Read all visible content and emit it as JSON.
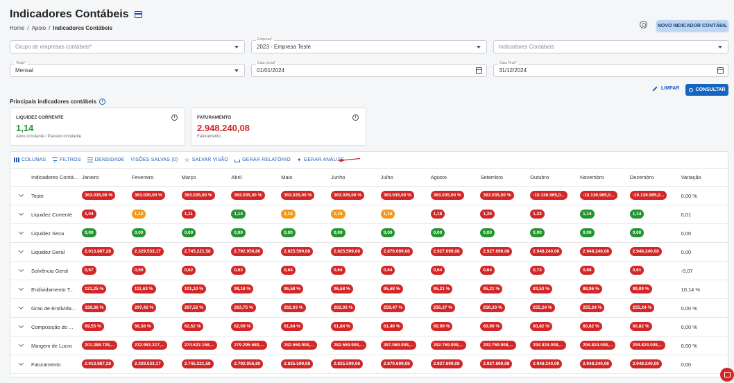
{
  "page": {
    "title": "Indicadores Contábeis",
    "breadcrumb": [
      "Home",
      "/",
      "Apoio",
      "/",
      "Indicadores Contábeis"
    ],
    "new_button": "NOVO INDICADOR CONTÁBIL"
  },
  "filters": {
    "grupo": {
      "placeholder": "Grupo de empresas contábeis*"
    },
    "empresa": {
      "label": "Empresa*",
      "value": "2023 - Empresa Teste"
    },
    "indicadores": {
      "placeholder": "Indicadores Contabeis"
    },
    "visao": {
      "label": "Visão*",
      "value": "Mensal"
    },
    "data_inicial": {
      "label": "Data Inicial*",
      "value": "01/01/2024"
    },
    "data_final": {
      "label": "Data Final*",
      "value": "31/12/2024"
    },
    "clear_button": "LIMPAR",
    "search_button": "CONSULTAR"
  },
  "summary": {
    "title": "Principais indicadores contábeis",
    "cards": [
      {
        "title": "LIQUIDEZ CORRENTE",
        "value": "1,14",
        "subtitle": "Ativo circulante / Passivo circulante",
        "color": "#23952f"
      },
      {
        "title": "FATURAMENTO",
        "value": "2.948.240,08",
        "subtitle": "Faturamento",
        "color": "#d32626"
      }
    ]
  },
  "toolbar": {
    "columns": "COLUNAS",
    "filters": "FILTROS",
    "density": "DENSIDADE",
    "saved_views": "VISÕES SALVAS (0)",
    "save_view": "SALVAR VISÃO",
    "report": "GERAR RELATÓRIO",
    "analysis": "GERAR ANÁLISE"
  },
  "table": {
    "headers": [
      "Indicadores Contá...",
      "Janeiro",
      "Fevereiro",
      "Março",
      "Abril",
      "Maio",
      "Junho",
      "Julho",
      "Agosto",
      "Setembro",
      "Outubro",
      "Novembro",
      "Dezembro",
      "Variação"
    ],
    "rows": [
      {
        "name": "Teste",
        "values": [
          "363.035,00 %",
          "363.035,00 %",
          "363.035,00 %",
          "363.035,00 %",
          "363.035,00 %",
          "363.035,00 %",
          "363.035,00 %",
          "363.035,00 %",
          "363.035,00 %",
          "-10.136.965,0...",
          "-10.136.965,0...",
          "-10.136.965,0..."
        ],
        "colors": [
          "r",
          "r",
          "r",
          "r",
          "r",
          "r",
          "r",
          "r",
          "r",
          "r",
          "r",
          "r"
        ],
        "variation": "0,00 %"
      },
      {
        "name": "Liquidez Corrente",
        "values": [
          "1,04",
          "1,12",
          "1,11",
          "1,14",
          "1,15",
          "1,15",
          "1,16",
          "1,18",
          "1,20",
          "1,22",
          "1,14",
          "1,14"
        ],
        "colors": [
          "r",
          "o",
          "r",
          "g",
          "o",
          "o",
          "o",
          "r",
          "r",
          "r",
          "g",
          "g"
        ],
        "variation": "0,01"
      },
      {
        "name": "Liquidez Seca",
        "values": [
          "0,00",
          "0,00",
          "0,00",
          "0,00",
          "0,00",
          "0,00",
          "0,00",
          "0,00",
          "0,00",
          "0,00",
          "0,00",
          "0,00"
        ],
        "colors": [
          "g",
          "g",
          "g",
          "g",
          "g",
          "g",
          "g",
          "g",
          "g",
          "g",
          "g",
          "g"
        ],
        "variation": "0,00"
      },
      {
        "name": "Liquidez Geral",
        "values": [
          "2.013.887,28",
          "2.329.533,17",
          "2.745.221,58",
          "2.792.956,80",
          "2.825.599,08",
          "2.825.599,08",
          "2.870.699,08",
          "2.927.699,08",
          "2.927.699,08",
          "2.948.240,08",
          "2.948.240,08",
          "2.948.240,08"
        ],
        "colors": [
          "r",
          "r",
          "r",
          "r",
          "r",
          "r",
          "r",
          "r",
          "r",
          "r",
          "r",
          "r"
        ],
        "variation": "0,00"
      },
      {
        "name": "Solvência Geral",
        "values": [
          "0,57",
          "0,59",
          "0,62",
          "0,63",
          "0,64",
          "0,64",
          "0,64",
          "0,64",
          "0,64",
          "0,73",
          "0,68",
          "0,61"
        ],
        "colors": [
          "r",
          "r",
          "r",
          "r",
          "r",
          "r",
          "r",
          "r",
          "r",
          "r",
          "r",
          "r"
        ],
        "variation": "-0,07"
      },
      {
        "name": "Endividamento T...",
        "values": [
          "121,25 %",
          "111,63 %",
          "101,10 %",
          "98,18 %",
          "96,58 %",
          "96,58 %",
          "95,68 %",
          "95,21 %",
          "95,21 %",
          "83,53 %",
          "88,96 %",
          "99,09 %"
        ],
        "colors": [
          "r",
          "r",
          "r",
          "r",
          "r",
          "r",
          "r",
          "r",
          "r",
          "r",
          "r",
          "r"
        ],
        "variation": "10,14 %"
      },
      {
        "name": "Grau de Endivida...",
        "values": [
          "328,36 %",
          "297,42 %",
          "267,52 %",
          "263,75 %",
          "262,03 %",
          "262,03 %",
          "259,47 %",
          "256,37 %",
          "256,33 %",
          "255,24 %",
          "255,24 %",
          "255,24 %"
        ],
        "colors": [
          "r",
          "r",
          "r",
          "r",
          "r",
          "r",
          "r",
          "r",
          "r",
          "r",
          "r",
          "r"
        ],
        "variation": "0,00 %"
      },
      {
        "name": "Composição do ...",
        "values": [
          "69,55 %",
          "66,38 %",
          "62,62 %",
          "62,09 %",
          "61,84 %",
          "61,84 %",
          "61,46 %",
          "60,99 %",
          "60,99 %",
          "60,82 %",
          "60,82 %",
          "60,82 %"
        ],
        "colors": [
          "r",
          "r",
          "r",
          "r",
          "r",
          "r",
          "r",
          "r",
          "r",
          "r",
          "r",
          "r"
        ],
        "variation": "0,00 %"
      },
      {
        "name": "Margem de Lucro",
        "values": [
          "201.388.728,...",
          "232.953.317,...",
          "274.522.158,...",
          "279.295.680,...",
          "282.559.908,...",
          "282.559.908,...",
          "287.069.908,...",
          "292.769.908,...",
          "292.769.908,...",
          "294.824.008,...",
          "294.824.008,...",
          "294.824.008,..."
        ],
        "colors": [
          "r",
          "r",
          "r",
          "r",
          "r",
          "r",
          "r",
          "r",
          "r",
          "r",
          "r",
          "r"
        ],
        "variation": "0,00 %"
      },
      {
        "name": "Faturamento",
        "values": [
          "2.013.887,28",
          "2.329.533,17",
          "2.745.221,58",
          "2.792.956,80",
          "2.825.599,08",
          "2.825.599,08",
          "2.870.699,08",
          "2.927.699,08",
          "2.927.699,08",
          "2.948.240,08",
          "2.948.240,08",
          "2.948.240,08"
        ],
        "colors": [
          "r",
          "r",
          "r",
          "r",
          "r",
          "r",
          "r",
          "r",
          "r",
          "r",
          "r",
          "r"
        ],
        "variation": "0,00"
      }
    ]
  },
  "colors": {
    "red": "#d32626",
    "green": "#23952f",
    "orange": "#f39a12",
    "primary": "#1565c0"
  }
}
